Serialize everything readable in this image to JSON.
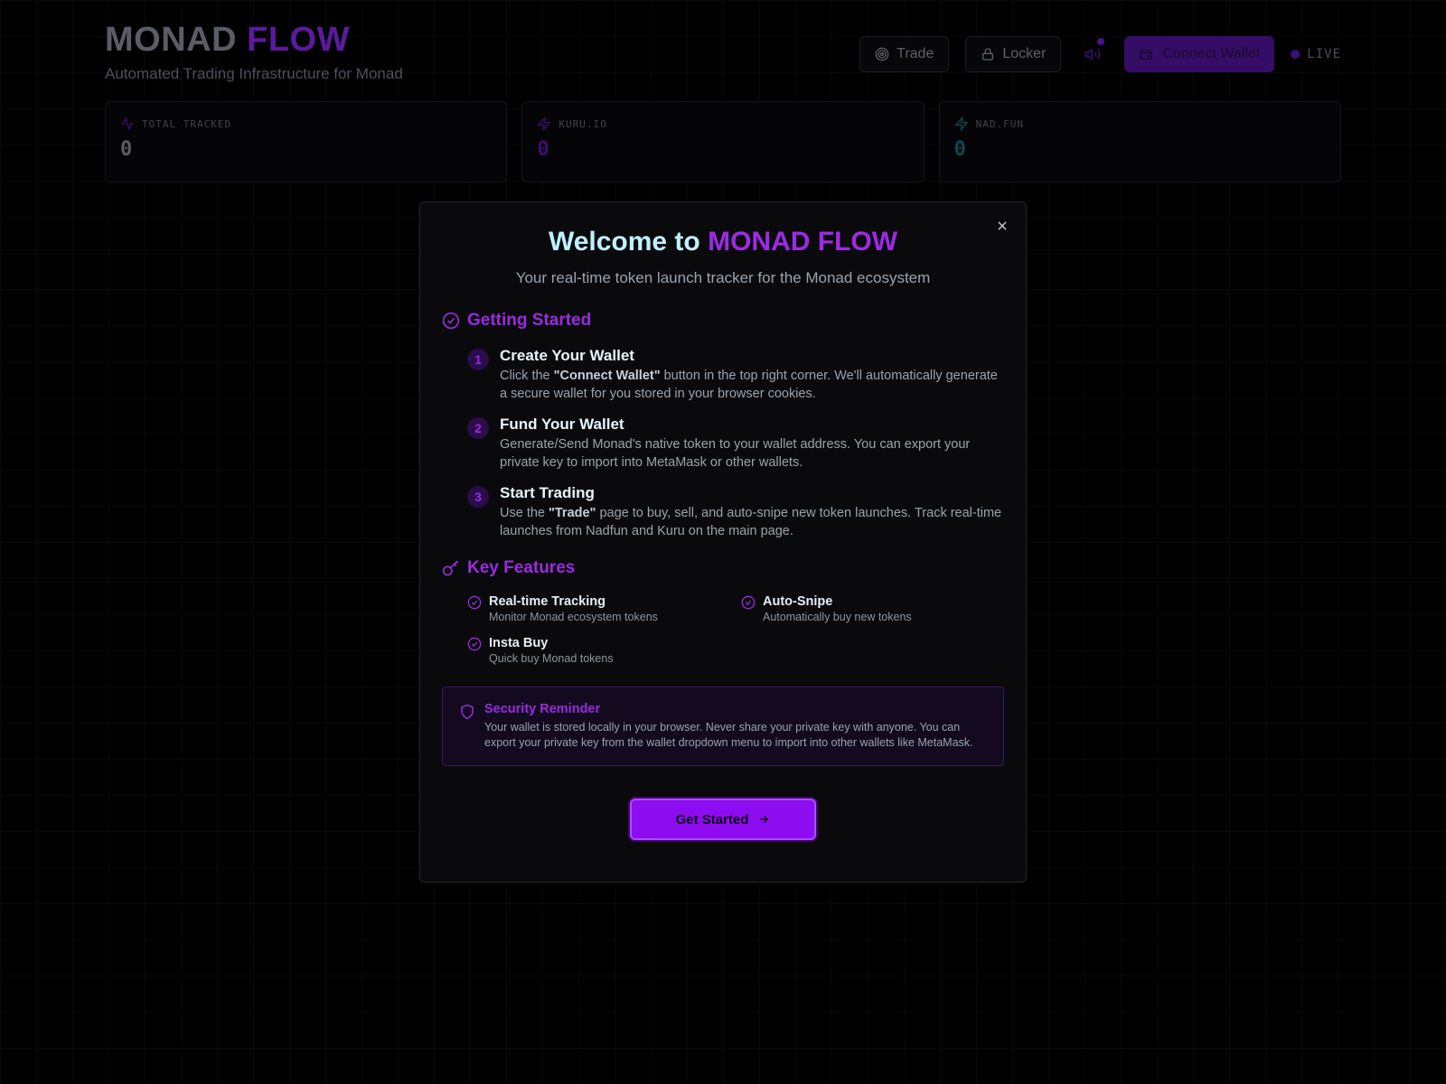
{
  "header": {
    "brand_word1": "MONAD",
    "brand_word2": "FLOW",
    "tagline": "Automated Trading Infrastructure for Monad",
    "nav": {
      "trade_label": "Trade",
      "locker_label": "Locker",
      "connect_label": "Connect Wallet",
      "live_label": "LIVE"
    }
  },
  "stats": [
    {
      "label": "TOTAL TRACKED",
      "value": "0",
      "color": "#5a5d66",
      "icon": "activity-icon"
    },
    {
      "label": "KURU.IO",
      "value": "0",
      "color": "#3a0f6b",
      "icon": "zap-icon"
    },
    {
      "label": "NAD.FUN",
      "value": "0",
      "color": "#11484f",
      "icon": "zap-icon"
    }
  ],
  "modal": {
    "title_prefix": "Welcome to",
    "title_brand": "MONAD FLOW",
    "subtitle": "Your real-time token launch tracker for the Monad ecosystem",
    "getting_started": {
      "heading": "Getting Started",
      "steps": [
        {
          "num": "1",
          "title": "Create Your Wallet",
          "desc_pre": "Click the ",
          "desc_bold": "\"Connect Wallet\"",
          "desc_post": " button in the top right corner. We'll automatically generate a secure wallet for you stored in your browser cookies."
        },
        {
          "num": "2",
          "title": "Fund Your Wallet",
          "desc_pre": "Generate/Send Monad's native token to your wallet address. You can export your private key to import into MetaMask or other wallets.",
          "desc_bold": "",
          "desc_post": ""
        },
        {
          "num": "3",
          "title": "Start Trading",
          "desc_pre": "Use the ",
          "desc_bold": "\"Trade\"",
          "desc_post": " page to buy, sell, and auto-snipe new token launches. Track real-time launches from Nadfun and Kuru on the main page."
        }
      ]
    },
    "key_features": {
      "heading": "Key Features",
      "items": [
        {
          "title": "Real-time Tracking",
          "desc": "Monitor Monad ecosystem tokens"
        },
        {
          "title": "Auto-Snipe",
          "desc": "Automatically buy new tokens"
        },
        {
          "title": "Insta Buy",
          "desc": "Quick buy Monad tokens"
        }
      ]
    },
    "security": {
      "title": "Security Reminder",
      "desc": "Your wallet is stored locally in your browser. Never share your private key with anyone. You can export your private key from the wallet dropdown menu to import into other wallets like MetaMask."
    },
    "cta_label": "Get Started"
  },
  "colors": {
    "accent": "#9a2ae0",
    "cta": "#8d0df0",
    "title_cyan": "#bff0ff"
  }
}
